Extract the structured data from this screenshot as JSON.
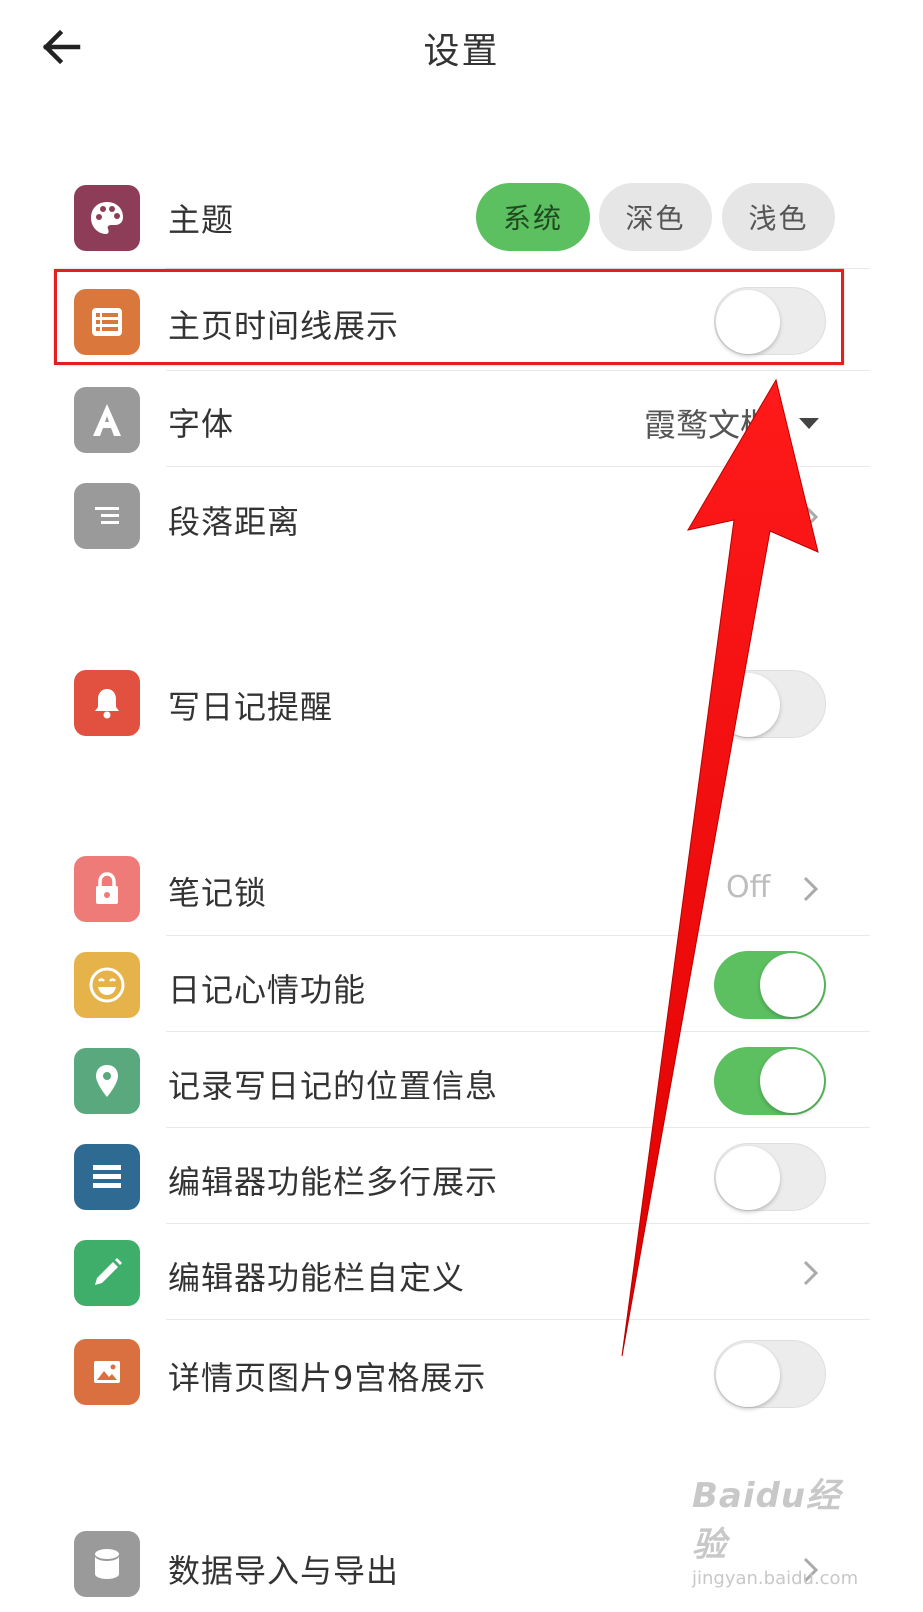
{
  "header": {
    "title": "设置"
  },
  "theme": {
    "label": "主题",
    "options": [
      "系统",
      "深色",
      "浅色"
    ],
    "selected": "系统"
  },
  "settings": {
    "timeline": {
      "label": "主页时间线展示",
      "enabled": false
    },
    "font": {
      "label": "字体",
      "value": "霞鹜文楷"
    },
    "paragraph": {
      "label": "段落距离"
    },
    "reminder": {
      "label": "写日记提醒",
      "enabled": false
    },
    "lock": {
      "label": "笔记锁",
      "value": "Off"
    },
    "mood": {
      "label": "日记心情功能",
      "enabled": true
    },
    "location": {
      "label": "记录写日记的位置信息",
      "enabled": true
    },
    "multiline": {
      "label": "编辑器功能栏多行展示",
      "enabled": false
    },
    "customize": {
      "label": "编辑器功能栏自定义"
    },
    "grid": {
      "label": "详情页图片9宫格展示",
      "enabled": false
    },
    "import_export": {
      "label": "数据导入与导出"
    }
  },
  "icons": {
    "theme": "palette-icon",
    "timeline": "list-icon",
    "font": "font-letter-icon",
    "paragraph": "paragraph-spacing-icon",
    "reminder": "bell-icon",
    "lock": "lock-icon",
    "mood": "smiley-icon",
    "location": "location-pin-icon",
    "multiline": "toolbar-lines-icon",
    "customize": "pencil-icon",
    "grid": "image-icon",
    "import_export": "database-icon"
  },
  "icon_colors": {
    "theme": "#8e3d58",
    "timeline": "#d9773d",
    "font": "#9a9a9a",
    "paragraph": "#9a9a9a",
    "reminder": "#e2503f",
    "lock": "#ee7b78",
    "mood": "#e6b34a",
    "location": "#5aa97e",
    "multiline": "#2f6a93",
    "customize": "#3fae6b",
    "grid": "#da6f3f",
    "import_export": "#9a9a9a"
  },
  "colors": {
    "toggle_on": "#5cbf60",
    "highlight": "#e41f22",
    "arrow": "#ff0d0d"
  },
  "watermark": {
    "line1": "Baidu经验",
    "line2": "jingyan.baidu.com"
  }
}
